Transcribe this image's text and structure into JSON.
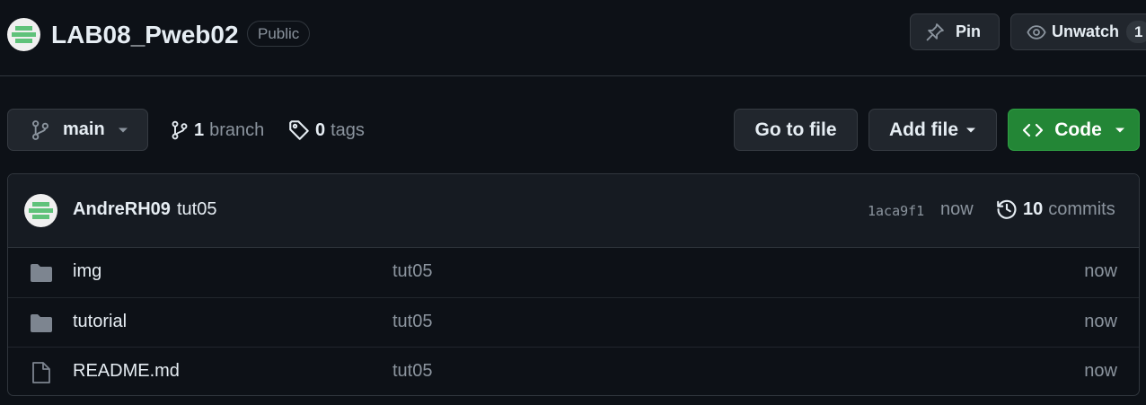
{
  "repo": {
    "name": "LAB08_Pweb02",
    "visibility": "Public"
  },
  "header_actions": {
    "pin_label": "Pin",
    "watch_label": "Unwatch",
    "watch_count": "1"
  },
  "toolbar": {
    "branch": "main",
    "branch_count": "1",
    "branch_label": "branch",
    "tag_count": "0",
    "tag_label": "tags",
    "goto_file_label": "Go to file",
    "add_file_label": "Add file",
    "code_label": "Code"
  },
  "latest_commit": {
    "author": "AndreRH09",
    "message": "tut05",
    "sha": "1aca9f1",
    "time": "now",
    "commit_count": "10",
    "commit_label": "commits"
  },
  "files": [
    {
      "name": "img",
      "type": "folder",
      "icon": "folder-icon",
      "message": "tut05",
      "time": "now"
    },
    {
      "name": "tutorial",
      "type": "folder",
      "icon": "folder-icon",
      "message": "tut05",
      "time": "now"
    },
    {
      "name": "README.md",
      "type": "file",
      "icon": "file-icon",
      "message": "tut05",
      "time": "now"
    }
  ],
  "colors": {
    "background": "#0d1117",
    "code_button": "#238636",
    "avatar_green": "#5fc27a"
  }
}
